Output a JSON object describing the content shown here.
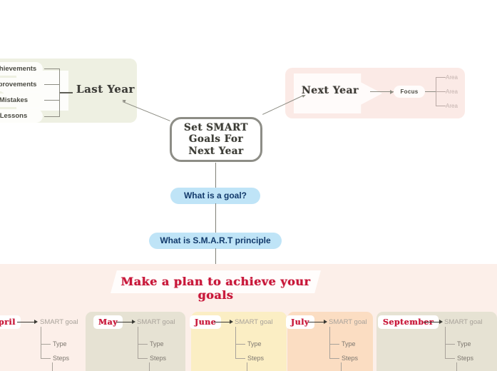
{
  "diagram": {
    "title": "Set SMART Goals For Next Year",
    "center_node": {
      "label": "Set SMART Goals For Next Year",
      "line1": "Set SMART",
      "line2": "Goals For",
      "line3": "Next Year"
    },
    "last_year": {
      "label": "Last Year",
      "panel_color": "#eef0e2",
      "items": [
        {
          "label": "Achievements"
        },
        {
          "label": "Improvements"
        },
        {
          "label": "Mistakes"
        },
        {
          "label": "Lessons"
        }
      ]
    },
    "next_year": {
      "label": "Next Year",
      "panel_color": "#fbeae6",
      "focus_label": "Focus",
      "areas": [
        {
          "label": "Area"
        },
        {
          "label": "Area"
        },
        {
          "label": "Area"
        }
      ]
    },
    "questions": [
      {
        "label": "What is a goal?",
        "color": "#bfe4f7",
        "text_color": "#123a6b"
      },
      {
        "label": "What is S.M.A.R.T principle",
        "color": "#bfe4f7",
        "text_color": "#123a6b"
      }
    ],
    "plan_banner": {
      "label": "Make a plan to achieve your goals",
      "text_color": "#c81638",
      "background": "#fffdfc"
    },
    "section_background": "#fcefe9",
    "months": [
      {
        "name": "April",
        "card_color": "#fcefe9",
        "goal_label": "SMART goal",
        "children": [
          {
            "label": "Type"
          },
          {
            "label": "Steps"
          }
        ]
      },
      {
        "name": "May",
        "card_color": "#e6e2d3",
        "goal_label": "SMART goal",
        "children": [
          {
            "label": "Type"
          },
          {
            "label": "Steps"
          }
        ]
      },
      {
        "name": "June",
        "card_color": "#fbeec4",
        "goal_label": "SMART goal",
        "children": [
          {
            "label": "Type"
          },
          {
            "label": "Steps"
          }
        ]
      },
      {
        "name": "July",
        "card_color": "#fbddc2",
        "goal_label": "SMART goal",
        "children": [
          {
            "label": "Type"
          },
          {
            "label": "Steps"
          }
        ]
      },
      {
        "name": "September",
        "card_color": "#e6e2d3",
        "goal_label": "SMART goal",
        "children": [
          {
            "label": "Type"
          },
          {
            "label": "Steps"
          }
        ]
      }
    ]
  }
}
